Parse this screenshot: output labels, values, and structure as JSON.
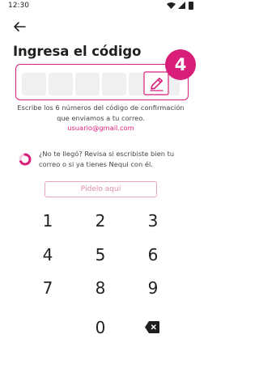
{
  "status_bar": {
    "time": "12:30"
  },
  "header": {
    "title": "Ingresa el código"
  },
  "code_entry": {
    "digits": [
      "",
      "",
      "",
      "",
      "",
      ""
    ],
    "step_number": "4"
  },
  "hint": {
    "text": "Escribe los 6 números del código de confirmación que enviamos a tu correo.",
    "email": "usuario@gmail.com"
  },
  "resend": {
    "help_text": "¿No te llegó? Revisa si escribiste bien tu correo o si ya tienes Nequi con él.",
    "button_label": "Pídelo aquí"
  },
  "keypad": {
    "keys": [
      "1",
      "2",
      "3",
      "4",
      "5",
      "6",
      "7",
      "8",
      "9",
      "0"
    ]
  },
  "colors": {
    "accent": "#d91e79",
    "cell_background": "#f0eff2",
    "disabled_button_text": "#e08ab1"
  }
}
